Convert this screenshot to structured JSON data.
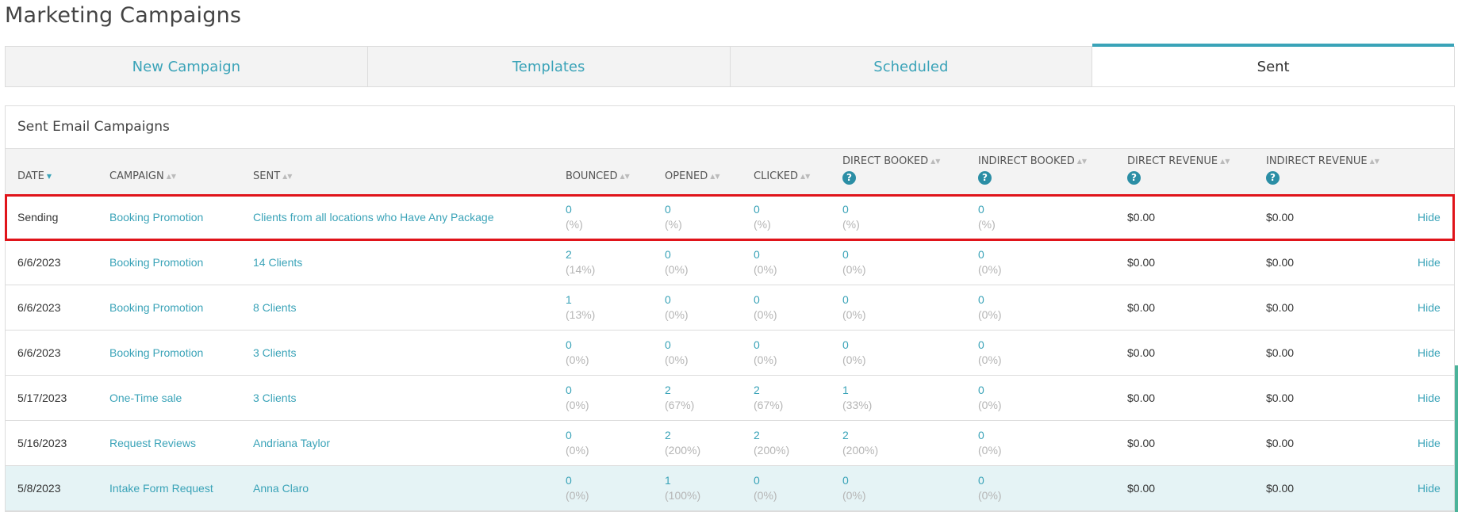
{
  "page": {
    "title": "Marketing Campaigns"
  },
  "tabs": [
    {
      "label": "New Campaign",
      "active": false
    },
    {
      "label": "Templates",
      "active": false
    },
    {
      "label": "Scheduled",
      "active": false
    },
    {
      "label": "Sent",
      "active": true
    }
  ],
  "panel": {
    "title": "Sent Email Campaigns"
  },
  "columns": {
    "date": "DATE",
    "campaign": "CAMPAIGN",
    "sent": "SENT",
    "bounced": "BOUNCED",
    "opened": "OPENED",
    "clicked": "CLICKED",
    "direct_booked": "DIRECT BOOKED",
    "indirect_booked": "INDIRECT BOOKED",
    "direct_revenue": "DIRECT REVENUE",
    "indirect_revenue": "INDIRECT REVENUE",
    "help": "?"
  },
  "colors": {
    "accent": "#3aa3b8",
    "selected_outline": "#e0141a",
    "highlight_row": "#e5f3f5"
  },
  "rows": [
    {
      "date": "Sending",
      "campaign": "Booking Promotion",
      "sent": "Clients from all locations who Have Any Package",
      "bounced": "0",
      "bounced_pct": "(%)",
      "opened": "0",
      "opened_pct": "(%)",
      "clicked": "0",
      "clicked_pct": "(%)",
      "direct_booked": "0",
      "direct_booked_pct": "(%)",
      "indirect_booked": "0",
      "indirect_booked_pct": "(%)",
      "direct_revenue": "$0.00",
      "indirect_revenue": "$0.00",
      "action": "Hide"
    },
    {
      "date": "6/6/2023",
      "campaign": "Booking Promotion",
      "sent": "14 Clients",
      "bounced": "2",
      "bounced_pct": "(14%)",
      "opened": "0",
      "opened_pct": "(0%)",
      "clicked": "0",
      "clicked_pct": "(0%)",
      "direct_booked": "0",
      "direct_booked_pct": "(0%)",
      "indirect_booked": "0",
      "indirect_booked_pct": "(0%)",
      "direct_revenue": "$0.00",
      "indirect_revenue": "$0.00",
      "action": "Hide"
    },
    {
      "date": "6/6/2023",
      "campaign": "Booking Promotion",
      "sent": "8 Clients",
      "bounced": "1",
      "bounced_pct": "(13%)",
      "opened": "0",
      "opened_pct": "(0%)",
      "clicked": "0",
      "clicked_pct": "(0%)",
      "direct_booked": "0",
      "direct_booked_pct": "(0%)",
      "indirect_booked": "0",
      "indirect_booked_pct": "(0%)",
      "direct_revenue": "$0.00",
      "indirect_revenue": "$0.00",
      "action": "Hide"
    },
    {
      "date": "6/6/2023",
      "campaign": "Booking Promotion",
      "sent": "3 Clients",
      "bounced": "0",
      "bounced_pct": "(0%)",
      "opened": "0",
      "opened_pct": "(0%)",
      "clicked": "0",
      "clicked_pct": "(0%)",
      "direct_booked": "0",
      "direct_booked_pct": "(0%)",
      "indirect_booked": "0",
      "indirect_booked_pct": "(0%)",
      "direct_revenue": "$0.00",
      "indirect_revenue": "$0.00",
      "action": "Hide"
    },
    {
      "date": "5/17/2023",
      "campaign": "One-Time sale",
      "sent": "3 Clients",
      "bounced": "0",
      "bounced_pct": "(0%)",
      "opened": "2",
      "opened_pct": "(67%)",
      "clicked": "2",
      "clicked_pct": "(67%)",
      "direct_booked": "1",
      "direct_booked_pct": "(33%)",
      "indirect_booked": "0",
      "indirect_booked_pct": "(0%)",
      "direct_revenue": "$0.00",
      "indirect_revenue": "$0.00",
      "action": "Hide"
    },
    {
      "date": "5/16/2023",
      "campaign": "Request Reviews",
      "sent": "Andriana Taylor",
      "bounced": "0",
      "bounced_pct": "(0%)",
      "opened": "2",
      "opened_pct": "(200%)",
      "clicked": "2",
      "clicked_pct": "(200%)",
      "direct_booked": "2",
      "direct_booked_pct": "(200%)",
      "indirect_booked": "0",
      "indirect_booked_pct": "(0%)",
      "direct_revenue": "$0.00",
      "indirect_revenue": "$0.00",
      "action": "Hide"
    },
    {
      "date": "5/8/2023",
      "campaign": "Intake Form Request",
      "sent": "Anna Claro",
      "bounced": "0",
      "bounced_pct": "(0%)",
      "opened": "1",
      "opened_pct": "(100%)",
      "clicked": "0",
      "clicked_pct": "(0%)",
      "direct_booked": "0",
      "direct_booked_pct": "(0%)",
      "indirect_booked": "0",
      "indirect_booked_pct": "(0%)",
      "direct_revenue": "$0.00",
      "indirect_revenue": "$0.00",
      "action": "Hide"
    }
  ]
}
